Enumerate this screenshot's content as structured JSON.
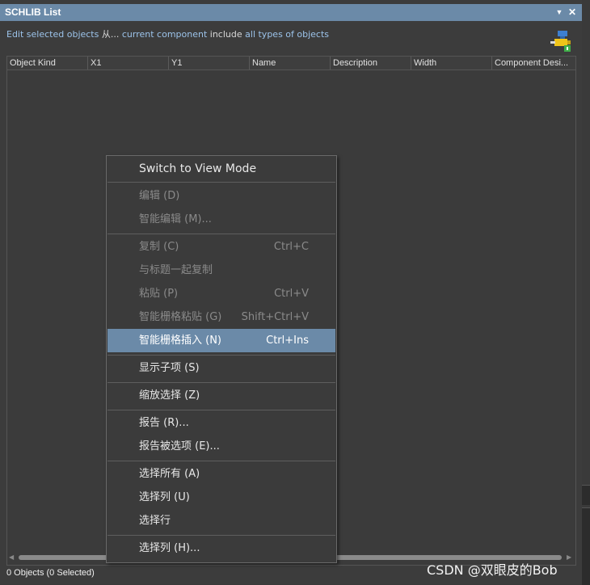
{
  "window": {
    "title": "SCHLIB List"
  },
  "filter": {
    "edit_link": "Edit selected objects",
    "from_text": "从...",
    "scope_link": "current component",
    "include_text": "include",
    "types_link": "all types of objects"
  },
  "grid": {
    "columns": [
      "Object Kind",
      "X1",
      "Y1",
      "Name",
      "Description",
      "Width",
      "Component Desi..."
    ]
  },
  "status": {
    "text": "0 Objects (0 Selected)"
  },
  "watermark": "CSDN @双眼皮的Bob",
  "context_menu": {
    "items": [
      {
        "label": "Switch to View Mode",
        "shortcut": "",
        "state": "enabled"
      },
      {
        "label": "编辑 (D)",
        "shortcut": "",
        "state": "disabled"
      },
      {
        "label": "智能编辑 (M)...",
        "shortcut": "",
        "state": "disabled"
      },
      {
        "label": "复制 (C)",
        "shortcut": "Ctrl+C",
        "state": "disabled"
      },
      {
        "label": "与标题一起复制",
        "shortcut": "",
        "state": "disabled"
      },
      {
        "label": "粘贴 (P)",
        "shortcut": "Ctrl+V",
        "state": "disabled"
      },
      {
        "label": "智能栅格粘贴 (G)",
        "shortcut": "Shift+Ctrl+V",
        "state": "disabled"
      },
      {
        "label": "智能栅格插入 (N)",
        "shortcut": "Ctrl+Ins",
        "state": "highlighted"
      },
      {
        "label": "显示子项 (S)",
        "shortcut": "",
        "state": "enabled"
      },
      {
        "label": "缩放选择 (Z)",
        "shortcut": "",
        "state": "enabled"
      },
      {
        "label": "报告 (R)...",
        "shortcut": "",
        "state": "enabled"
      },
      {
        "label": "报告被选项 (E)...",
        "shortcut": "",
        "state": "enabled"
      },
      {
        "label": "选择所有 (A)",
        "shortcut": "",
        "state": "enabled"
      },
      {
        "label": "选择列 (U)",
        "shortcut": "",
        "state": "enabled"
      },
      {
        "label": "选择行",
        "shortcut": "",
        "state": "enabled"
      },
      {
        "label": "选择列 (H)...",
        "shortcut": "",
        "state": "enabled"
      }
    ]
  },
  "colors": {
    "title_bar": "#6b8aa8",
    "link": "#9cc3ea",
    "highlight": "#6b8aa8",
    "panel_bg": "#3c3c3c"
  },
  "icons": {
    "pin": "pin-dropdown-icon",
    "close": "close-icon",
    "filter": "plug-filter-icon",
    "scroll_left": "scroll-left-arrow-icon",
    "scroll_right": "scroll-right-arrow-icon"
  }
}
